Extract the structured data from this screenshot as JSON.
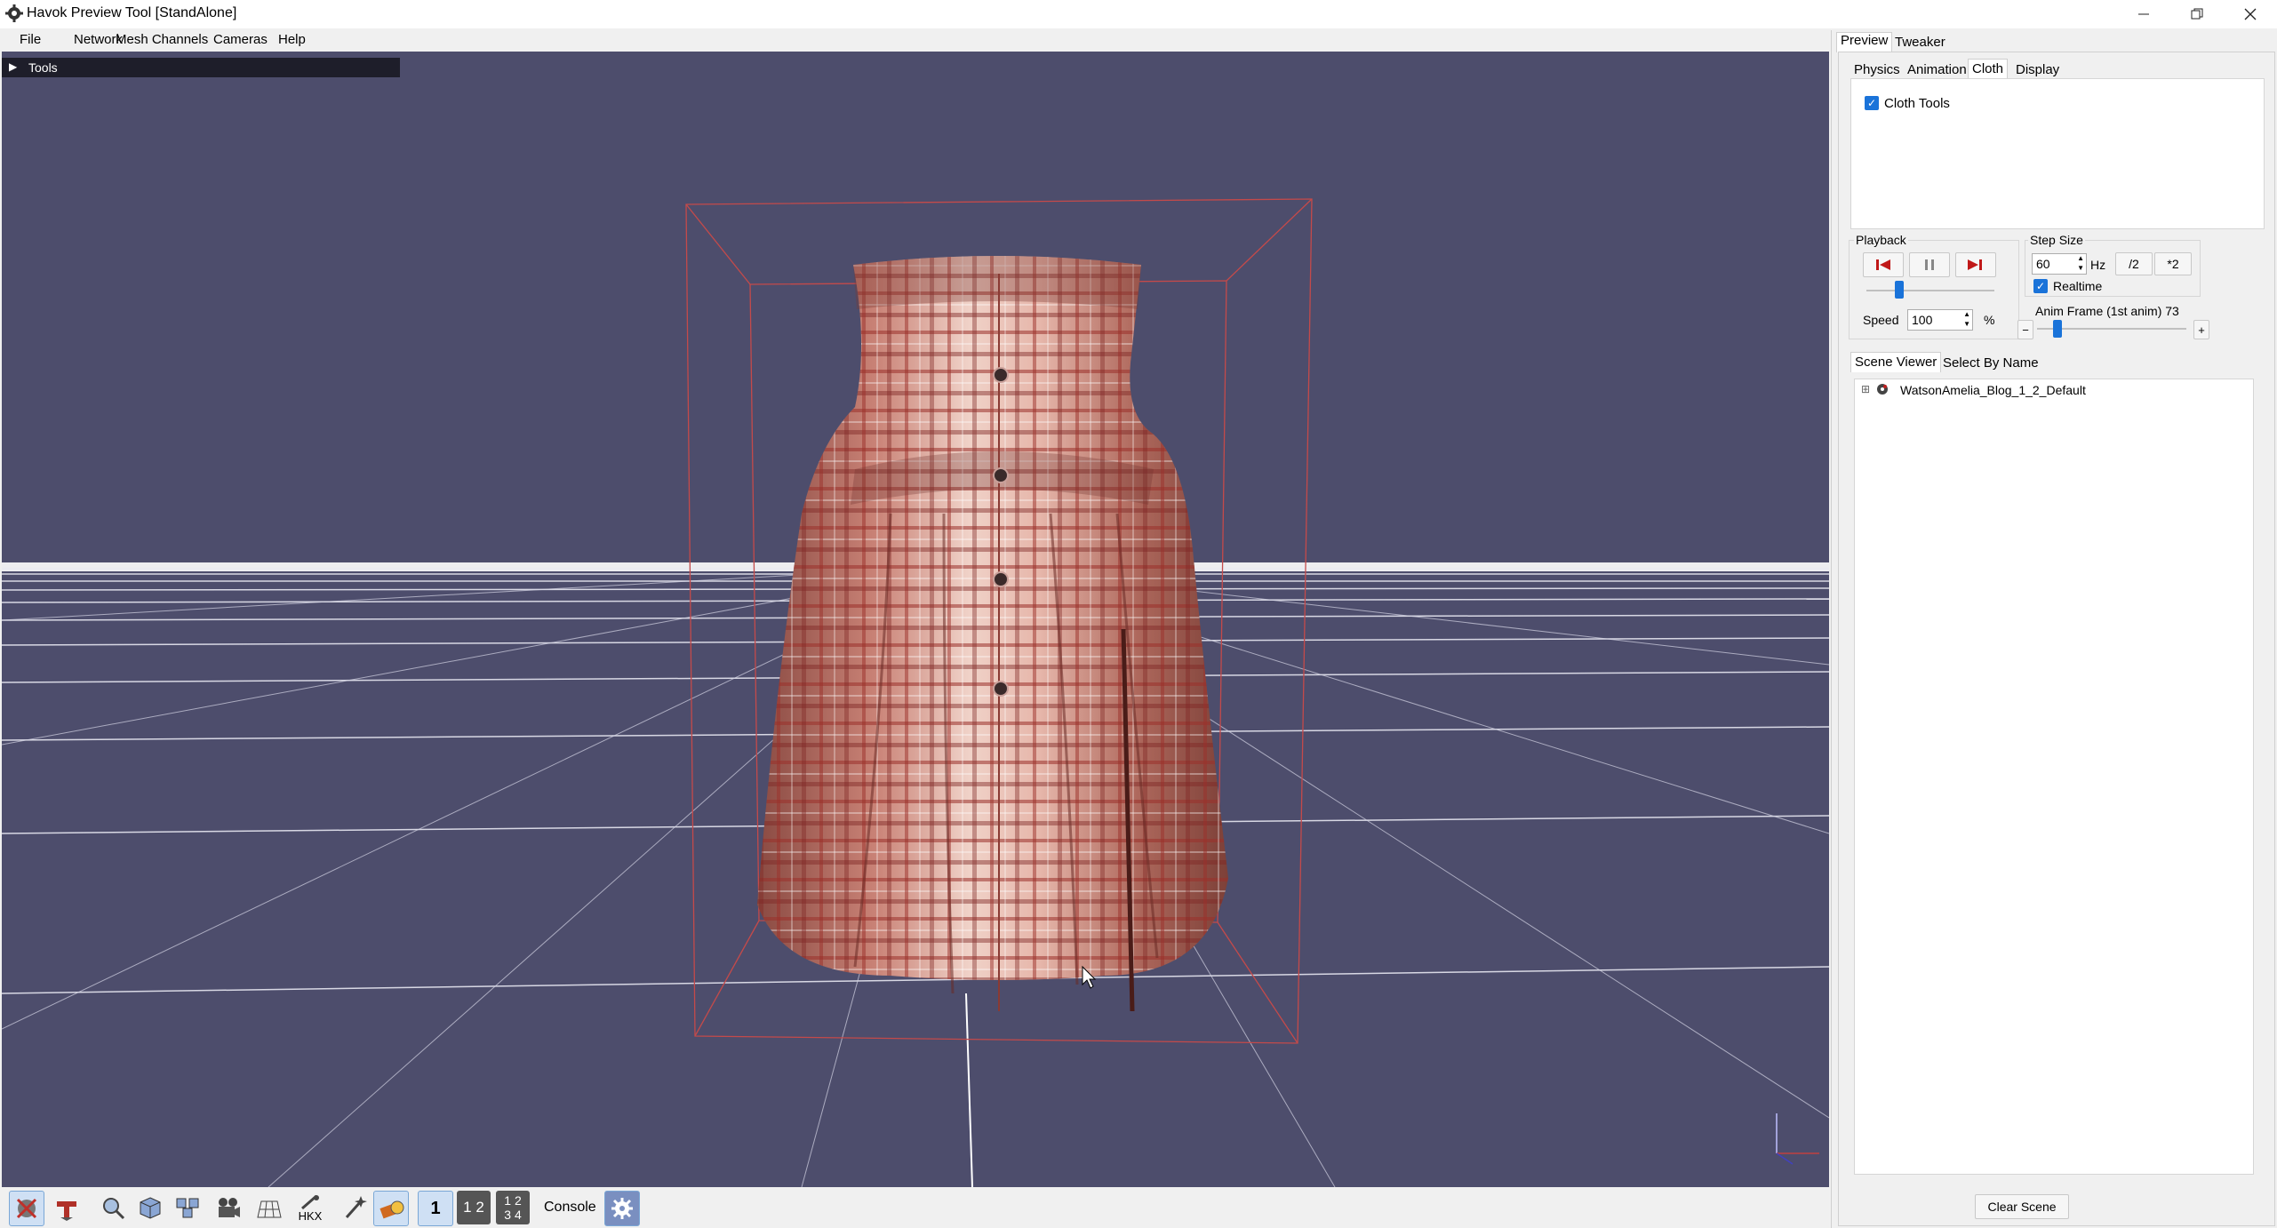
{
  "window": {
    "title": "Havok Preview Tool [StandAlone]"
  },
  "menu": [
    "File",
    "Network",
    "Mesh Channels",
    "Cameras",
    "Help"
  ],
  "viewport": {
    "tools_label": "Tools"
  },
  "toolbar": {
    "hkx_label": "HKX",
    "layout1": "1",
    "layout2": "1 2",
    "layout4_top": "1 2",
    "layout4_bottom": "3 4",
    "console_label": "Console"
  },
  "right_panel": {
    "top_tabs": [
      "Preview",
      "Tweaker"
    ],
    "sub_tabs": [
      "Physics",
      "Animation",
      "Cloth",
      "Display"
    ],
    "cloth_tools_label": "Cloth Tools",
    "cloth_tools_checked": true,
    "playback": {
      "title": "Playback",
      "speed_label": "Speed",
      "speed_value": "100",
      "speed_unit": "%"
    },
    "step_size": {
      "title": "Step Size",
      "value": "60",
      "unit": "Hz",
      "half_label": "/2",
      "double_label": "*2",
      "realtime_label": "Realtime",
      "realtime_checked": true,
      "anim_frame_label": "Anim Frame (1st anim) 73",
      "minus": "−",
      "plus": "+"
    },
    "scene_tabs": [
      "Scene Viewer",
      "Select By Name"
    ],
    "scene_tree": [
      {
        "label": "WatsonAmelia_Blog_1_2_Default",
        "expand": "⊞"
      }
    ],
    "clear_scene_label": "Clear Scene"
  },
  "colors": {
    "viewport_bg": "#4d4d6c",
    "accent": "#1a73d9",
    "bounding_box": "#c44a4a",
    "skirt_base": "#c97a6e"
  }
}
